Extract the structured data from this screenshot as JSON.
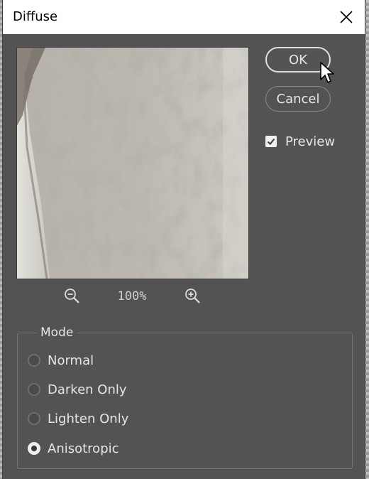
{
  "dialog": {
    "title": "Diffuse",
    "close_icon": "close-icon"
  },
  "buttons": {
    "ok_label": "OK",
    "cancel_label": "Cancel"
  },
  "preview_toggle": {
    "label": "Preview",
    "checked": true
  },
  "zoom": {
    "level": "100%",
    "zoom_out_icon": "zoom-out-icon",
    "zoom_in_icon": "zoom-in-icon"
  },
  "mode": {
    "legend": "Mode",
    "options": [
      {
        "label": "Normal",
        "selected": false
      },
      {
        "label": "Darken Only",
        "selected": false
      },
      {
        "label": "Lighten Only",
        "selected": false
      },
      {
        "label": "Anisotropic",
        "selected": true
      }
    ]
  },
  "colors": {
    "dialog_bg": "#535353",
    "titlebar_bg": "#ffffff",
    "text": "#e6e6e6",
    "checkbox_fill": "#f0f0f0"
  }
}
